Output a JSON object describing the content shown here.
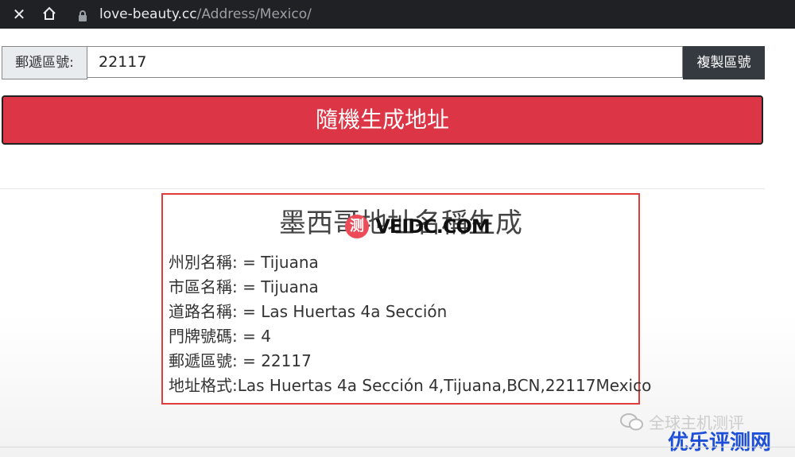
{
  "browser": {
    "url_domain": "love-beauty.cc",
    "url_path": "/Address/Mexico/",
    "close_icon": "close-icon",
    "home_icon": "home-icon",
    "lock_icon": "lock-icon"
  },
  "zip_section": {
    "label": "郵遞區號:",
    "value": "22117",
    "copy_button": "複製區號"
  },
  "generate_button": "隨機生成地址",
  "result": {
    "title": "墨西哥地址名稱生成",
    "lines": [
      "州別名稱: = Tijuana",
      "市區名稱: = Tijuana",
      "道路名稱: = Las Huertas 4a Sección",
      "門牌號碼: = 4",
      "郵遞區號: = 22117",
      "地址格式:Las Huertas 4a Sección 4,Tijuana,BCN,22117Mexico"
    ]
  },
  "watermarks": {
    "mid_badge": "测",
    "mid_text": "VEIDC.COM",
    "bottom_text": "全球主机测评",
    "brand": "优乐评测网"
  },
  "colors": {
    "generate_button": "#dc3545",
    "copy_button": "#343a40",
    "result_border": "#e03c3c",
    "brand": "#1e4fd8"
  }
}
